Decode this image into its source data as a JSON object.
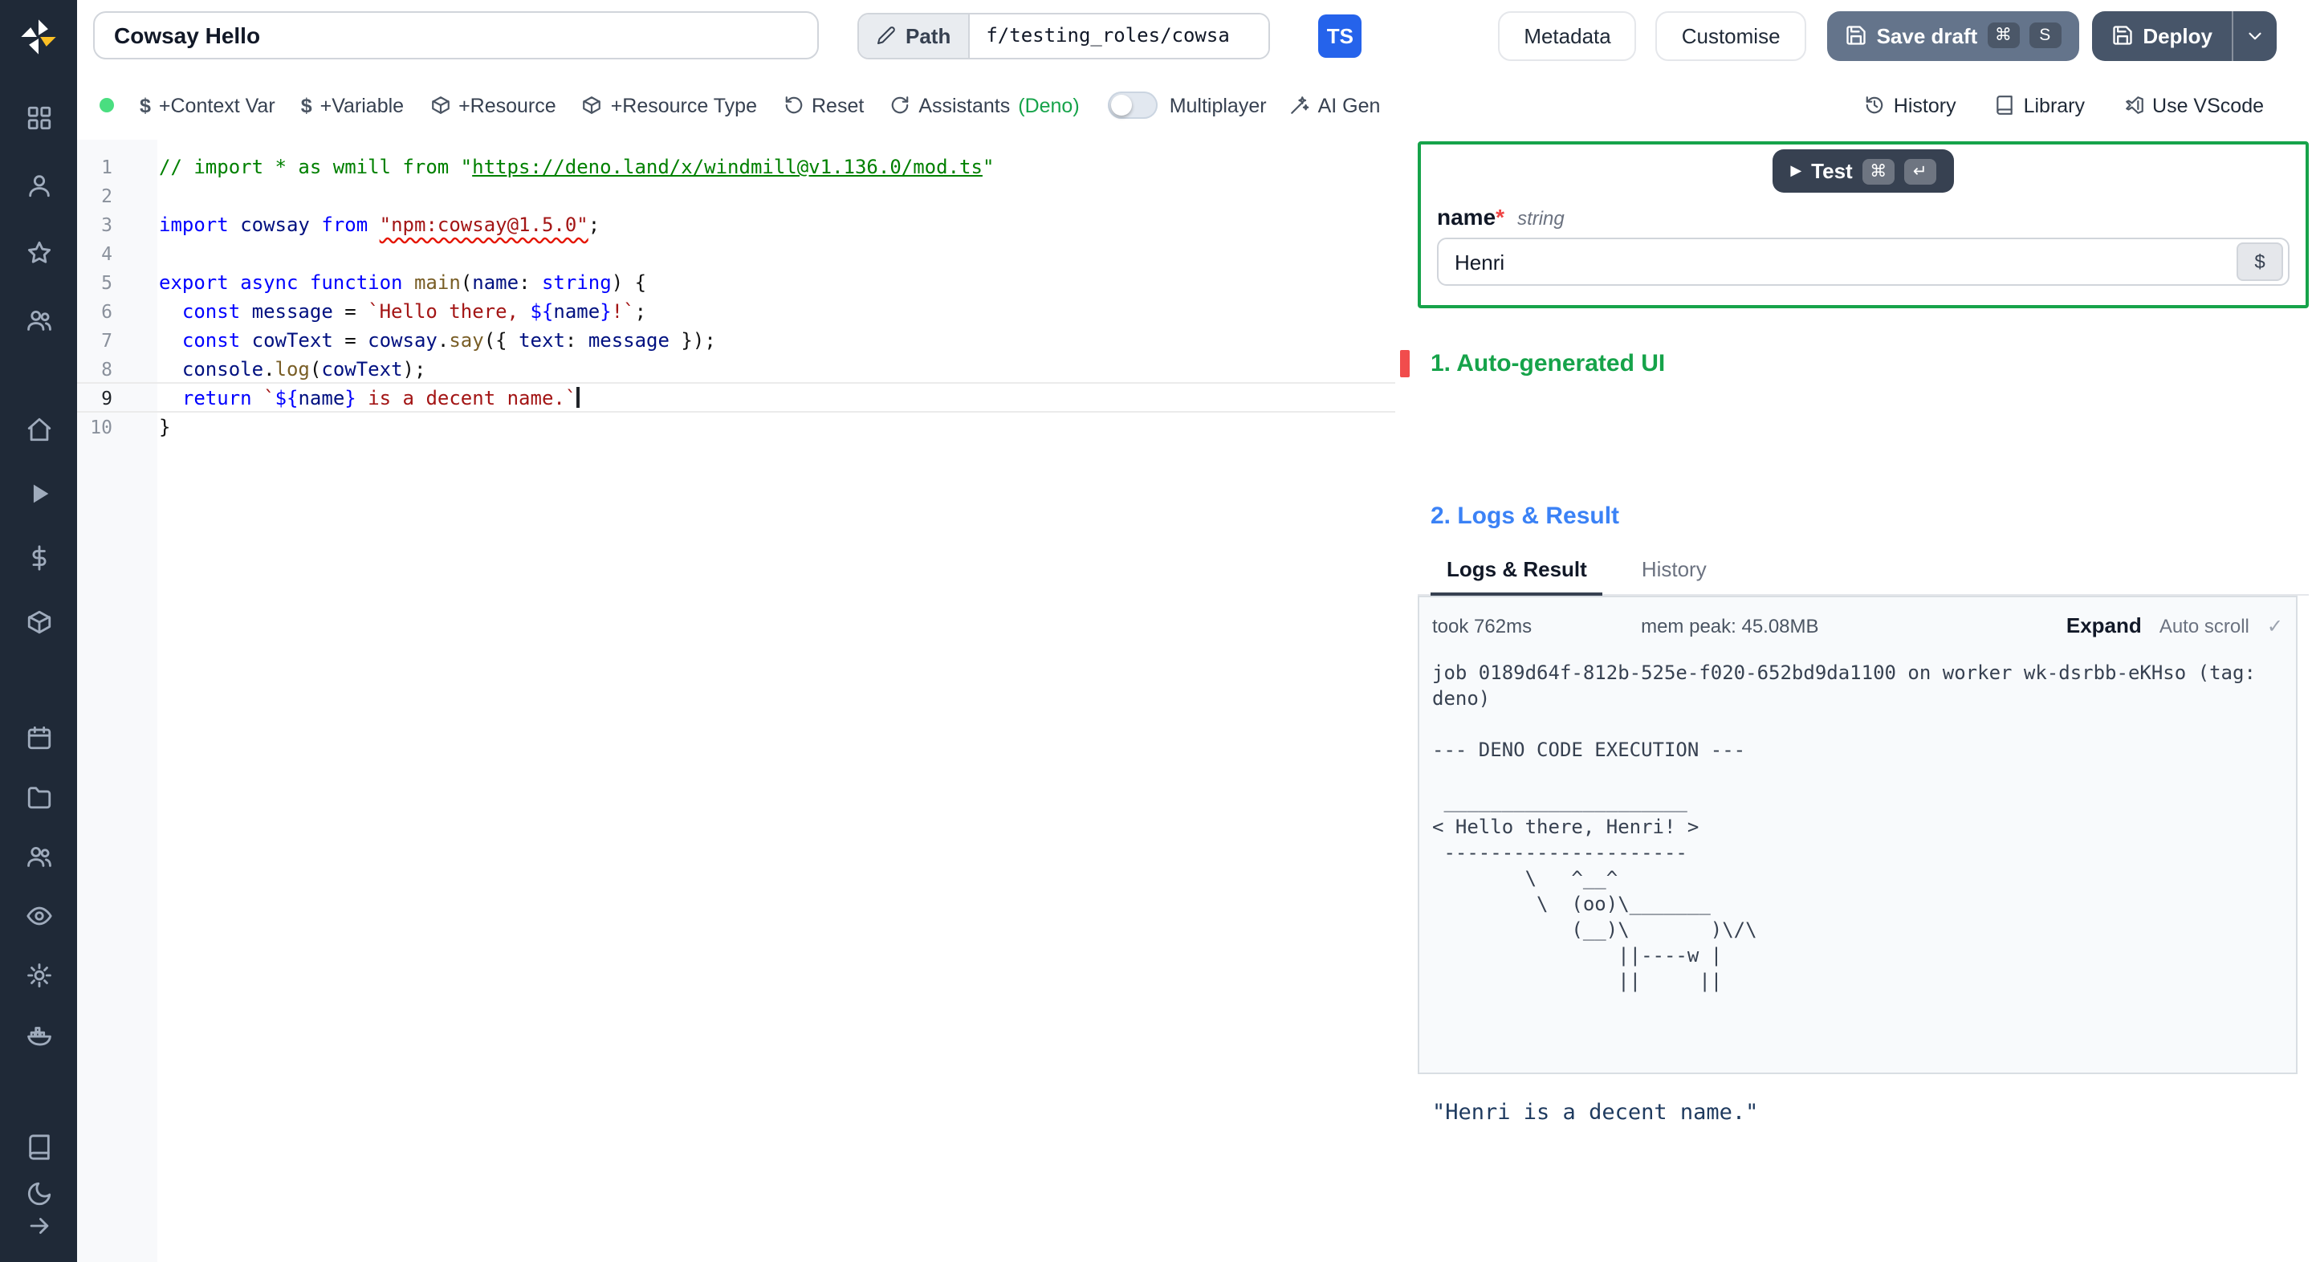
{
  "colors": {
    "green_accent": "#16a34a",
    "blue_accent": "#3b82f6",
    "ts_badge": "#2563eb",
    "save_button": "#64748b",
    "deploy_button": "#475569",
    "error_marker": "#f14c4c",
    "status_dot": "#4ade80",
    "sidebar_bg": "#1f2937"
  },
  "sidebar": {
    "groups": [
      [
        "grid",
        "user",
        "star",
        "users"
      ],
      [
        "home",
        "play",
        "dollar",
        "package"
      ],
      [
        "calendar",
        "folder",
        "user-group",
        "eye",
        "gear",
        "docker"
      ],
      [
        "book",
        "moon"
      ]
    ],
    "bottom": "arrow-right"
  },
  "topbar": {
    "title_value": "Cowsay Hello",
    "path_label": "Path",
    "path_value": "f/testing_roles/cowsa",
    "lang_badge": "TS",
    "metadata": "Metadata",
    "customise": "Customise",
    "save_draft": "Save draft",
    "save_keys": [
      "⌘",
      "S"
    ],
    "deploy": "Deploy"
  },
  "toolbar": {
    "dollar": "$",
    "context_var": "+Context Var",
    "variable": "+Variable",
    "resource": "+Resource",
    "resource_type": "+Resource Type",
    "reset": "Reset",
    "assistants": "Assistants",
    "assistants_lang": "(Deno)",
    "multiplayer": "Multiplayer",
    "ai_gen": "AI Gen",
    "history": "History",
    "library": "Library",
    "use_vscode": "Use VScode"
  },
  "editor": {
    "current_line": 9,
    "lines": [
      [
        [
          "c",
          "// import * as wmill from \""
        ],
        [
          "cl",
          "https://deno.land/x/windmill@v1.136.0/mod.ts"
        ],
        [
          "c",
          "\""
        ]
      ],
      [],
      [
        [
          "k",
          "import"
        ],
        [
          "d",
          " "
        ],
        [
          "v",
          "cowsay"
        ],
        [
          "d",
          " "
        ],
        [
          "k",
          "from"
        ],
        [
          "d",
          " "
        ],
        [
          "se",
          "\"npm:cowsay@1.5.0\""
        ],
        [
          "d",
          ";"
        ]
      ],
      [],
      [
        [
          "k",
          "export"
        ],
        [
          "d",
          " "
        ],
        [
          "k",
          "async"
        ],
        [
          "d",
          " "
        ],
        [
          "k",
          "function"
        ],
        [
          "d",
          " "
        ],
        [
          "f",
          "main"
        ],
        [
          "d",
          "("
        ],
        [
          "v",
          "name"
        ],
        [
          "d",
          ": "
        ],
        [
          "k",
          "string"
        ],
        [
          "d",
          ") {"
        ]
      ],
      [
        [
          "d",
          "  "
        ],
        [
          "k",
          "const"
        ],
        [
          "d",
          " "
        ],
        [
          "v",
          "message"
        ],
        [
          "d",
          " = "
        ],
        [
          "s",
          "`Hello there, "
        ],
        [
          "k",
          "${"
        ],
        [
          "v",
          "name"
        ],
        [
          "k",
          "}"
        ],
        [
          "s",
          "!`"
        ],
        [
          "d",
          ";"
        ]
      ],
      [
        [
          "d",
          "  "
        ],
        [
          "k",
          "const"
        ],
        [
          "d",
          " "
        ],
        [
          "v",
          "cowText"
        ],
        [
          "d",
          " = "
        ],
        [
          "v",
          "cowsay"
        ],
        [
          "d",
          "."
        ],
        [
          "f",
          "say"
        ],
        [
          "d",
          "({ "
        ],
        [
          "v",
          "text"
        ],
        [
          "d",
          ": "
        ],
        [
          "v",
          "message"
        ],
        [
          "d",
          " });"
        ]
      ],
      [
        [
          "d",
          "  "
        ],
        [
          "v",
          "console"
        ],
        [
          "d",
          "."
        ],
        [
          "f",
          "log"
        ],
        [
          "d",
          "("
        ],
        [
          "v",
          "cowText"
        ],
        [
          "d",
          ");"
        ]
      ],
      [
        [
          "d",
          "  "
        ],
        [
          "k",
          "return"
        ],
        [
          "d",
          " "
        ],
        [
          "s",
          "`"
        ],
        [
          "k",
          "${"
        ],
        [
          "v",
          "name"
        ],
        [
          "k",
          "}"
        ],
        [
          "s",
          " is a decent name.`"
        ]
      ],
      [
        [
          "d",
          "}"
        ]
      ]
    ]
  },
  "panel": {
    "test": "Test",
    "test_keys": [
      "⌘",
      "↵"
    ],
    "arg_name": "name",
    "required_mark": "*",
    "arg_type": "string",
    "arg_value": "Henri",
    "dollar_btn": "$",
    "section1": "1. Auto-generated UI",
    "section2": "2. Logs & Result",
    "tabs": [
      "Logs & Result",
      "History"
    ],
    "stats": {
      "took": "took 762ms",
      "mem": "mem peak: 45.08MB",
      "expand": "Expand",
      "autoscroll": "Auto scroll",
      "check": "✓"
    },
    "log_lines": [
      "job 0189d64f-812b-525e-f020-652bd9da1100 on worker wk-dsrbb-eKHso (tag:",
      "deno)",
      "",
      "--- DENO CODE EXECUTION ---",
      "",
      " _____________________",
      "< Hello there, Henri! >",
      " ---------------------",
      "        \\   ^__^",
      "         \\  (oo)\\_______",
      "            (__)\\       )\\/\\",
      "                ||----w |",
      "                ||     ||"
    ],
    "result": "\"Henri is a decent name.\""
  }
}
